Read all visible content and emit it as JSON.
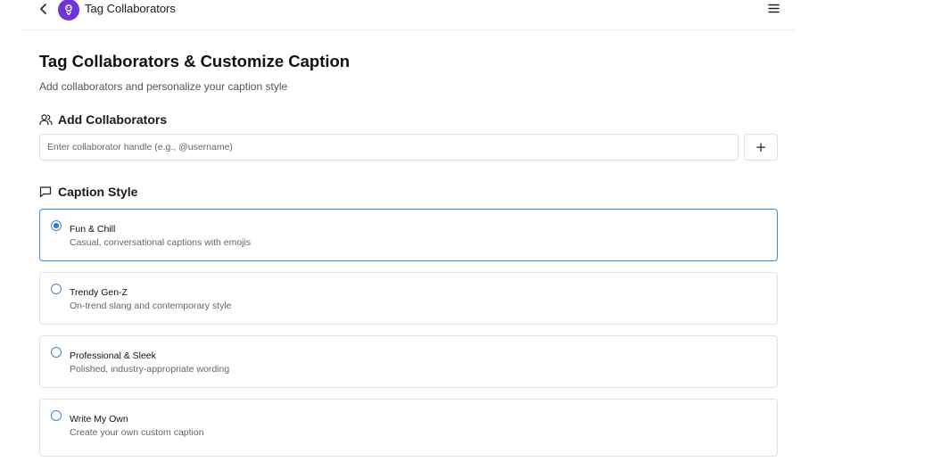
{
  "header": {
    "title": "Tag Collaborators"
  },
  "page": {
    "title": "Tag Collaborators & Customize Caption",
    "subtitle": "Add collaborators and personalize your caption style"
  },
  "collaborators": {
    "heading": "Add Collaborators",
    "input_placeholder": "Enter collaborator handle (e.g., @username)",
    "input_value": "",
    "add_label": "+"
  },
  "caption_style": {
    "heading": "Caption Style",
    "selected": "Fun & Chill",
    "options": [
      {
        "label": "Fun & Chill",
        "description": "Casual, conversational captions with emojis",
        "checked": true
      },
      {
        "label": "Trendy Gen-Z",
        "description": "On-trend slang and contemporary style",
        "checked": false
      },
      {
        "label": "Professional & Sleek",
        "description": "Polished, industry-appropriate wording",
        "checked": false
      },
      {
        "label": "Write My Own",
        "description": "Create your own custom caption",
        "checked": false
      }
    ]
  },
  "colors": {
    "brand": "#6d35d8",
    "accent": "#3a8fd6"
  }
}
